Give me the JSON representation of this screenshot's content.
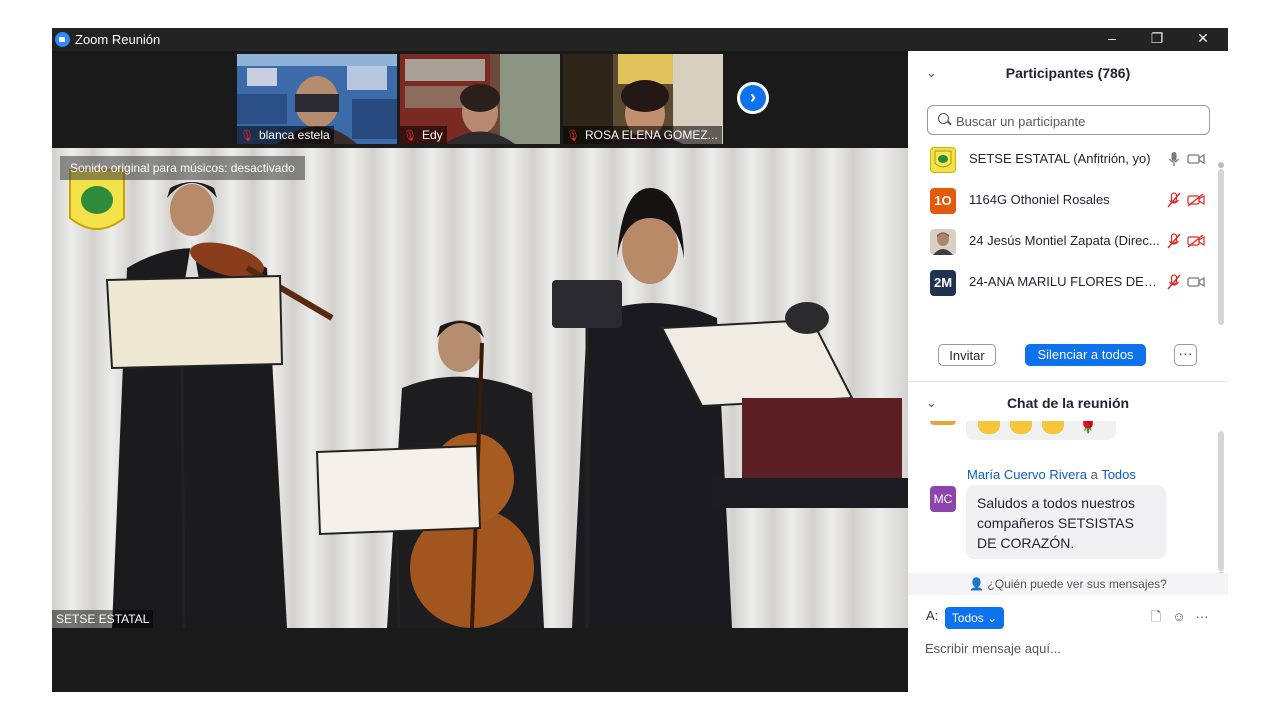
{
  "window": {
    "title": "Zoom Reunión",
    "controls": {
      "minimize": "–",
      "restore": "❐",
      "close": "✕"
    }
  },
  "gallery": {
    "thumbnails": [
      {
        "name": "blanca estela",
        "muted": true
      },
      {
        "name": "Edy",
        "muted": true
      },
      {
        "name": "ROSA ELENA GOMEZ...",
        "muted": true
      }
    ],
    "next_icon": "chevron-right-icon"
  },
  "main_video": {
    "original_sound": "Sonido original para músicos: desactivado",
    "speaker": "SETSE ESTATAL"
  },
  "participants": {
    "title": "Participantes (786)",
    "search_placeholder": "Buscar un participante",
    "list": [
      {
        "initials": "",
        "name": "SETSE ESTATAL (Anfitrión, yo)",
        "avatar_color": "#f2e14c",
        "mic": "on",
        "cam": "on"
      },
      {
        "initials": "1O",
        "name": "1164G Othoniel Rosales",
        "avatar_color": "#e35a0c",
        "mic": "off",
        "cam": "off"
      },
      {
        "initials": "",
        "name": "24 Jesús Montiel Zapata (Direc...",
        "avatar_color": "#b9a98c",
        "mic": "off",
        "cam": "off"
      },
      {
        "initials": "2M",
        "name": "24-ANA MARILU FLORES DEL A...",
        "avatar_color": "#1f3350",
        "mic": "off",
        "cam": "on"
      }
    ],
    "invite_label": "Invitar",
    "mute_all_label": "Silenciar a todos",
    "more_label": "···"
  },
  "chat": {
    "title": "Chat de la reunión",
    "message": {
      "sender": "María Cuervo Rivera",
      "connector": "a",
      "recipient": "Todos",
      "initials": "MC",
      "text": "Saludos a todos nuestros compañeros SETSISTAS DE CORAZÓN."
    },
    "who_can_see": "¿Quién puede ver sus mensajes?",
    "to_label": "A:",
    "to_value": "Todos",
    "compose_placeholder": "Escribir mensaje aquí..."
  },
  "colors": {
    "accent": "#0e72ed",
    "muted_red": "#e02828",
    "titlebar": "#232323"
  }
}
